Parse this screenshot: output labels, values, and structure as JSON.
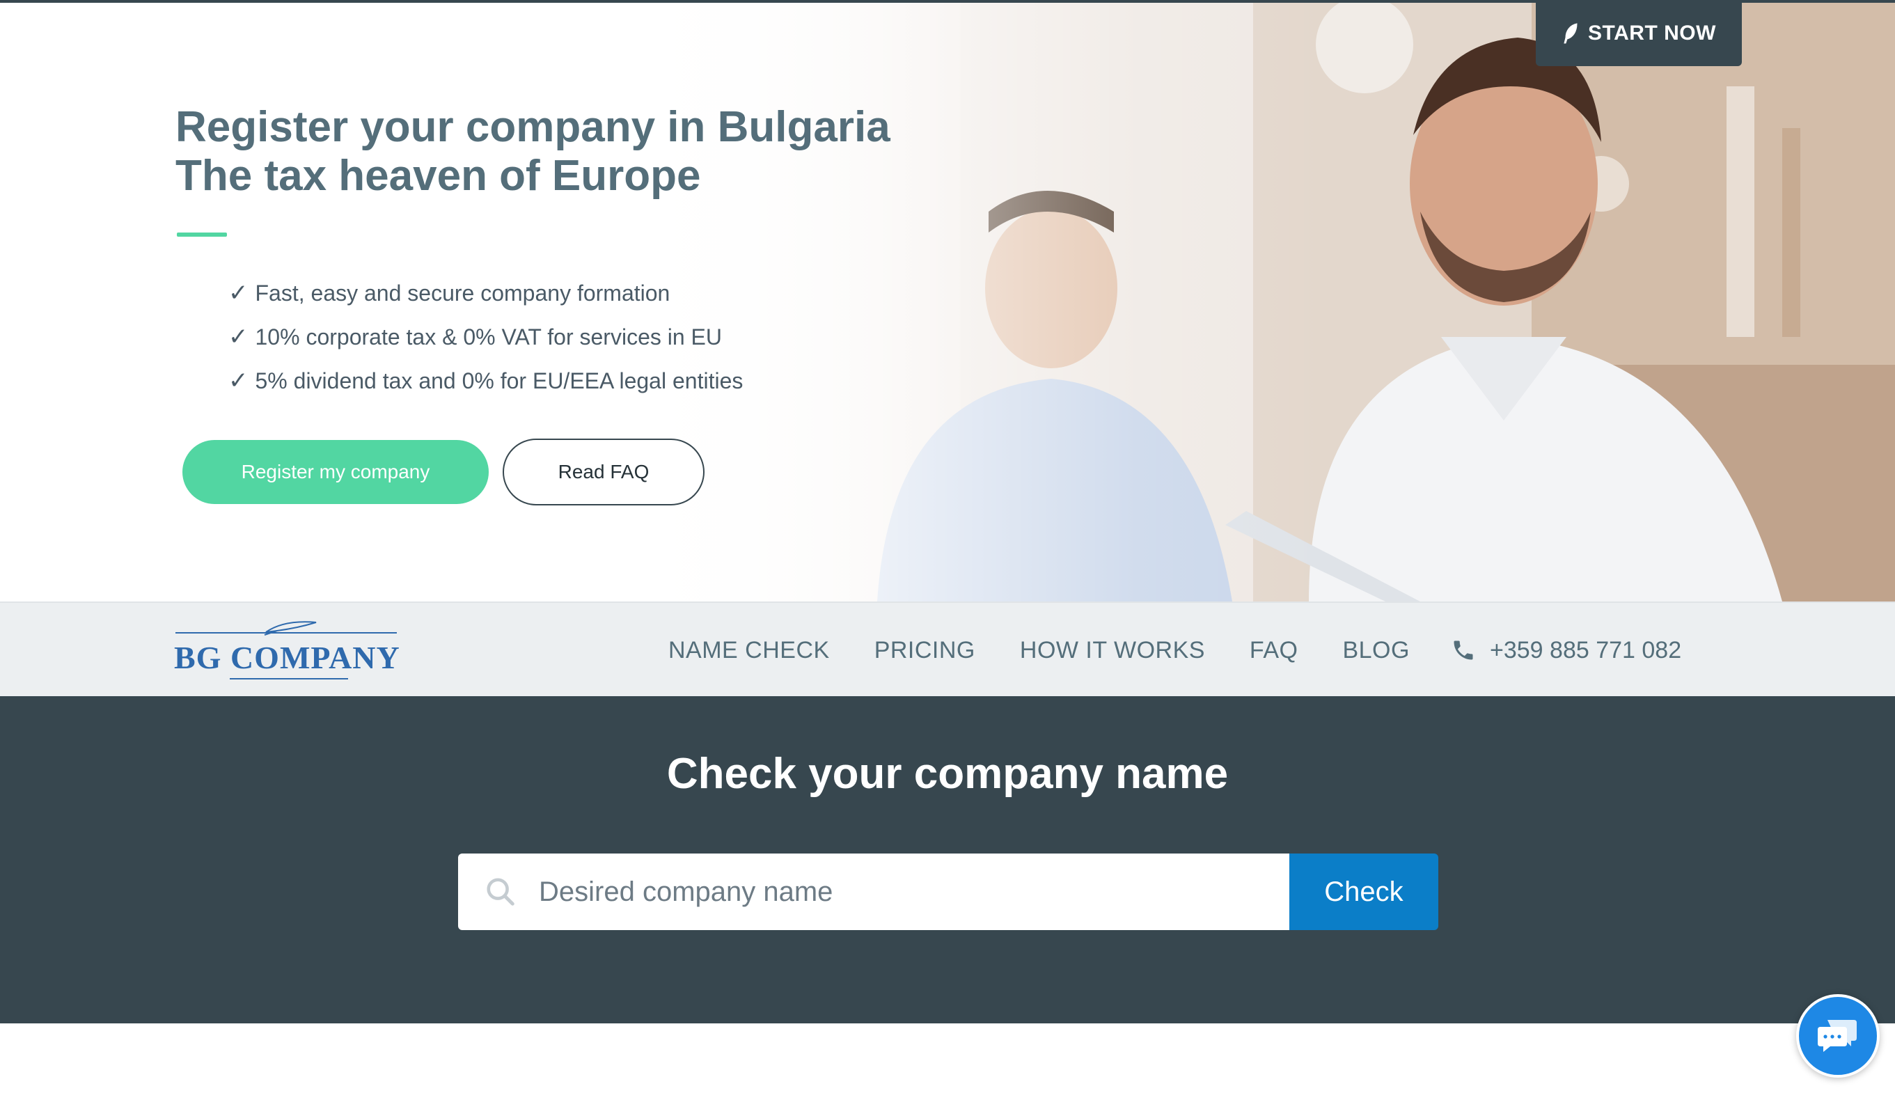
{
  "hero": {
    "title_line1": "Register your company in Bulgaria",
    "title_line2": "The tax heaven of Europe",
    "features": [
      "Fast, easy and secure company formation",
      "10% corporate tax & 0% VAT for services in EU",
      "5% dividend tax and 0% for EU/EEA legal entities"
    ],
    "check_glyph": "✓",
    "register_button": "Register my company",
    "faq_button": "Read FAQ",
    "start_now": "START NOW"
  },
  "nav": {
    "logo": "BG COMPANY",
    "items": [
      "NAME CHECK",
      "PRICING",
      "HOW IT WORKS",
      "FAQ",
      "BLOG"
    ],
    "phone": "+359 885 771 082",
    "phone_icon": "phone-icon"
  },
  "name_check": {
    "title": "Check your company name",
    "placeholder": "Desired company name",
    "button": "Check",
    "search_icon": "search-icon"
  },
  "chat": {
    "icon": "chat-icon"
  },
  "colors": {
    "accent_green": "#52d6a2",
    "dark_slate": "#37474f",
    "primary_blue": "#0b7ec8",
    "chat_blue": "#1e88e5",
    "logo_blue": "#2f6aad"
  }
}
